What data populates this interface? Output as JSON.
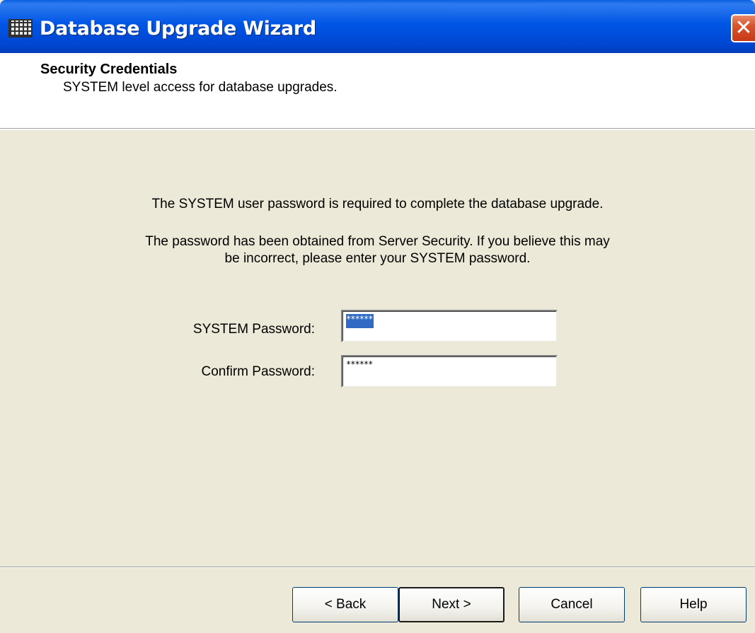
{
  "window": {
    "title": "Database Upgrade Wizard",
    "close_glyph": "✕"
  },
  "header": {
    "title": "Security Credentials",
    "subtitle": "SYSTEM level access for database upgrades."
  },
  "body": {
    "message_1": "The SYSTEM user password is required to complete the database upgrade.",
    "message_2_line1": "The password has been obtained from Server Security. If you believe this may",
    "message_2_line2": "be incorrect, please enter your SYSTEM password."
  },
  "form": {
    "system_password_label": "SYSTEM Password:",
    "system_password_value": "******",
    "confirm_password_label": "Confirm Password:",
    "confirm_password_value": "******"
  },
  "buttons": {
    "back": "< Back",
    "next": "Next >",
    "cancel": "Cancel",
    "help": "Help"
  },
  "colors": {
    "titlebar": "#0055e5",
    "face": "#ece9d8",
    "selection": "#316ac5",
    "close": "#d9532d"
  },
  "icons": {
    "app": "database-grid-icon",
    "close": "close-icon"
  }
}
